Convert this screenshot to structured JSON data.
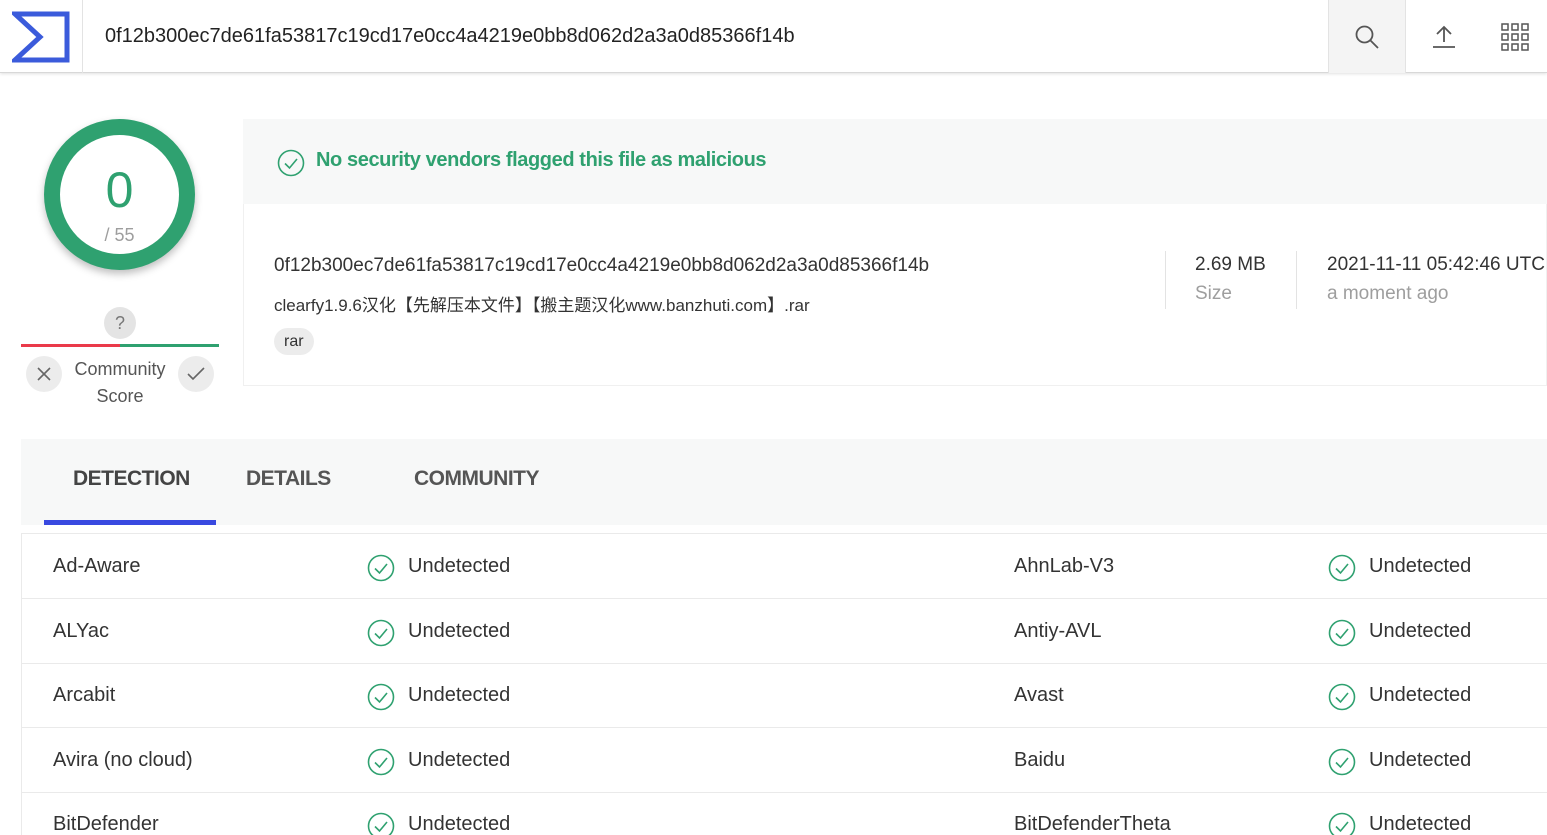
{
  "search": {
    "value": "0f12b300ec7de61fa53817c19cd17e0cc4a4219e0bb8d062d2a3a0d85366f14b"
  },
  "score": {
    "detections": "0",
    "total": "/ 55"
  },
  "community": {
    "question": "?",
    "label_line1": "Community",
    "label_line2": "Score"
  },
  "banner": {
    "text": "No security vendors flagged this file as malicious"
  },
  "file": {
    "hash": "0f12b300ec7de61fa53817c19cd17e0cc4a4219e0bb8d062d2a3a0d85366f14b",
    "name": "clearfy1.9.6汉化【先解压本文件】【搬主题汉化www.banzhuti.com】.rar",
    "tag": "rar",
    "size": "2.69 MB",
    "size_label": "Size",
    "date": "2021-11-11 05:42:46 UTC",
    "date_label": "a moment ago"
  },
  "tabs": [
    {
      "label": "DETECTION"
    },
    {
      "label": "DETAILS"
    },
    {
      "label": "COMMUNITY"
    }
  ],
  "detections": [
    {
      "left": {
        "engine": "Ad-Aware",
        "result": "Undetected"
      },
      "right": {
        "engine": "AhnLab-V3",
        "result": "Undetected"
      }
    },
    {
      "left": {
        "engine": "ALYac",
        "result": "Undetected"
      },
      "right": {
        "engine": "Antiy-AVL",
        "result": "Undetected"
      }
    },
    {
      "left": {
        "engine": "Arcabit",
        "result": "Undetected"
      },
      "right": {
        "engine": "Avast",
        "result": "Undetected"
      }
    },
    {
      "left": {
        "engine": "Avira (no cloud)",
        "result": "Undetected"
      },
      "right": {
        "engine": "Baidu",
        "result": "Undetected"
      }
    },
    {
      "left": {
        "engine": "BitDefender",
        "result": "Undetected"
      },
      "right": {
        "engine": "BitDefenderTheta",
        "result": "Undetected"
      }
    }
  ],
  "colors": {
    "accent": "#3949e0",
    "clean": "#2fa170",
    "malicious": "#ea3a4a",
    "logo": "#3b5bdb"
  },
  "icons": [
    "virustotal-logo",
    "search-icon",
    "upload-icon",
    "apps-grid-icon",
    "check-circle-icon",
    "close-icon",
    "check-icon"
  ]
}
